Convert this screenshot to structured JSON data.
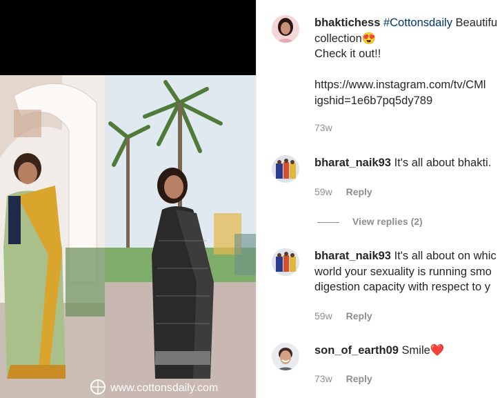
{
  "post": {
    "image_watermark": "www.cottonsdaily.com"
  },
  "comments": [
    {
      "username": "bhaktichess",
      "hashtag": "#Cottonsdaily",
      "text_after_tag": " Beautifu",
      "line2": "collection",
      "emoji": "😍",
      "line3": "Check it out!!",
      "line4": "https://www.instagram.com/tv/CMl",
      "line5": "igshid=1e6b7pq5dy789",
      "time": "73w"
    },
    {
      "username": "bharat_naik93",
      "text": " It's all about bhakti.",
      "time": "59w",
      "reply_label": "Reply",
      "view_replies": "View replies (2)"
    },
    {
      "username": "bharat_naik93",
      "text": " It's all about on whic",
      "line2": "world your sexuality is running smo",
      "line3": "digestion capacity with respect to y",
      "time": "59w",
      "reply_label": "Reply"
    },
    {
      "username": "son_of_earth09",
      "text": " Smile",
      "emoji": "❤️",
      "time": "73w",
      "reply_label": "Reply"
    }
  ]
}
